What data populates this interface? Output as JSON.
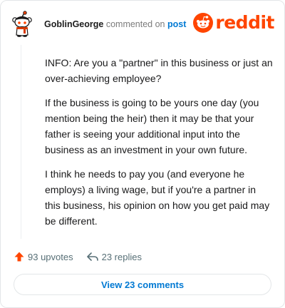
{
  "post": {
    "author": "GoblinGeorge",
    "action_text": "commented on",
    "target_text": "post"
  },
  "brand": {
    "word": "reddit",
    "color": "#ff4500"
  },
  "comment": {
    "paragraphs": [
      "INFO: Are you a \"partner\" in this business or just an over-achieving employee?",
      "If the business is going to be yours one day (you mention being the heir) then it may be that your father is seeing your additional input into the business as an investment in your own future.",
      "I think he needs to pay you (and everyone he employs) a living wage, but if you're a partner in this business, his opinion on how you get paid may be different."
    ]
  },
  "actions": {
    "upvote_icon": "upvote-arrow-icon",
    "upvotes_label": "93 upvotes",
    "reply_icon": "reply-arrow-icon",
    "replies_label": "23 replies"
  },
  "footer": {
    "view_comments_label": "View 23 comments"
  },
  "colors": {
    "accent_blue": "#0079d3",
    "upvote_orange": "#ff4500",
    "muted_text": "#576f76"
  }
}
